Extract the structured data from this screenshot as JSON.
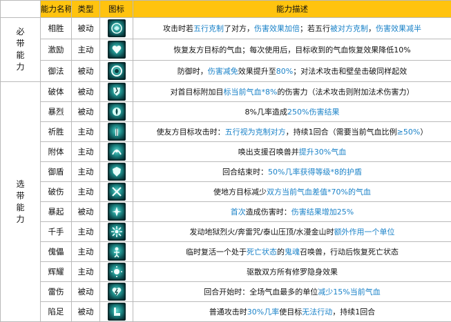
{
  "header": {
    "col_name": "能力名称",
    "col_type": "类型",
    "col_icon": "图标",
    "col_desc": "能力描述"
  },
  "groups": {
    "must": "必带能力",
    "optional": "选带能力"
  },
  "colors": {
    "header_bg": "#ffc30f",
    "highlight": "#1a82c8",
    "icon_bg": "#1f8d8a"
  },
  "rows": [
    {
      "name": "相胜",
      "type": "被动",
      "icon": "dragon-emblem-icon",
      "desc": [
        {
          "t": "攻击时若"
        },
        {
          "t": "五行克制",
          "h": 1
        },
        {
          "t": "了对方，"
        },
        {
          "t": "伤害效果加倍",
          "h": 1
        },
        {
          "t": "；若五行"
        },
        {
          "t": "被对方克制",
          "h": 1
        },
        {
          "t": "，"
        },
        {
          "t": "伤害效果减半",
          "h": 1
        }
      ]
    },
    {
      "name": "激励",
      "type": "主动",
      "icon": "heart-emblem-icon",
      "desc": [
        {
          "t": "恢复友方目标的气血；每次使用后，目标收到的气血恢复效果降低10%"
        }
      ]
    },
    {
      "name": "御法",
      "type": "被动",
      "icon": "shield-ring-icon",
      "desc": [
        {
          "t": "防御时，"
        },
        {
          "t": "伤害减免",
          "h": 1
        },
        {
          "t": "效果提升至"
        },
        {
          "t": "80%",
          "h": 1
        },
        {
          "t": "；对法术攻击和壁垒击破同样起效"
        }
      ]
    },
    {
      "name": "破体",
      "type": "被动",
      "icon": "broken-armor-icon",
      "desc": [
        {
          "t": "对首目标附加目"
        },
        {
          "t": "标当前气血*8%",
          "h": 1
        },
        {
          "t": "的伤害力（法术攻击则附加法术伤害力）"
        }
      ]
    },
    {
      "name": "暴烈",
      "type": "被动",
      "icon": "fire-orb-icon",
      "desc": [
        {
          "t": "8%几率造成"
        },
        {
          "t": "250%伤害结果",
          "h": 1
        }
      ]
    },
    {
      "name": "祈胜",
      "type": "主动",
      "icon": "prayer-hands-icon",
      "desc": [
        {
          "t": "使友方目标攻击时："
        },
        {
          "t": "五行视为克制对方",
          "h": 1
        },
        {
          "t": "，持续1回合（需要当前气血比例"
        },
        {
          "t": "≥50%",
          "h": 1
        },
        {
          "t": "）"
        }
      ]
    },
    {
      "name": "附体",
      "type": "主动",
      "icon": "spirit-possess-icon",
      "desc": [
        {
          "t": "唤出支援召唤兽并"
        },
        {
          "t": "提升30%气血",
          "h": 1
        }
      ]
    },
    {
      "name": "御盾",
      "type": "主动",
      "icon": "guard-shield-icon",
      "desc": [
        {
          "t": "回合结束时："
        },
        {
          "t": "50%几率获得",
          "h": 1
        },
        {
          "t": "等级*8的护盾",
          "h": 1
        }
      ]
    },
    {
      "name": "破伤",
      "type": "主动",
      "icon": "crossed-blades-icon",
      "desc": [
        {
          "t": "使地方目标减少"
        },
        {
          "t": "双方当前气血差值*70%的气血",
          "h": 1
        }
      ]
    },
    {
      "name": "暴起",
      "type": "被动",
      "icon": "rising-burst-icon",
      "desc": [
        {
          "t": "首次",
          "h": 1
        },
        {
          "t": "造成伤害时："
        },
        {
          "t": "伤害结果增加25%",
          "h": 1
        }
      ]
    },
    {
      "name": "千手",
      "type": "主动",
      "icon": "many-hands-icon",
      "desc": [
        {
          "t": "发动地狱烈火/奔雷咒/泰山压顶/水漫金山时"
        },
        {
          "t": "额外作用一个单位",
          "h": 1
        }
      ]
    },
    {
      "name": "傀儡",
      "type": "主动",
      "icon": "puppet-icon",
      "desc": [
        {
          "t": "临时复活一个处于"
        },
        {
          "t": "死亡状态",
          "h": 1
        },
        {
          "t": "的"
        },
        {
          "t": "鬼魂",
          "h": 1
        },
        {
          "t": "召唤兽，行动后恢复死亡状态"
        }
      ]
    },
    {
      "name": "辉耀",
      "type": "主动",
      "icon": "radiance-icon",
      "desc": [
        {
          "t": "驱散双方所有修罗隐身效果"
        }
      ]
    },
    {
      "name": "雷伤",
      "type": "被动",
      "icon": "lightning-heart-icon",
      "desc": [
        {
          "t": "回合开始时：全场气血最多的单位"
        },
        {
          "t": "减少15%当前气血",
          "h": 1
        }
      ]
    },
    {
      "name": "陷足",
      "type": "被动",
      "icon": "trapped-foot-icon",
      "desc": [
        {
          "t": "普通攻击时"
        },
        {
          "t": "30%几率",
          "h": 1
        },
        {
          "t": "使目标"
        },
        {
          "t": "无法行动",
          "h": 1
        },
        {
          "t": "，持续1回合"
        }
      ]
    }
  ]
}
